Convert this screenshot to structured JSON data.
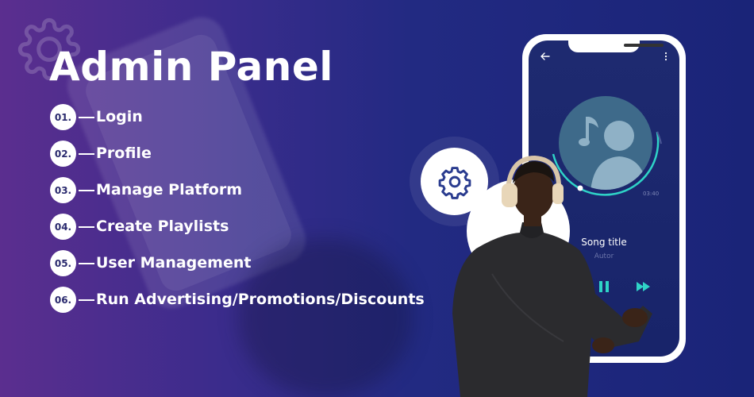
{
  "banner": {
    "title": "Admin Panel",
    "items": [
      {
        "number": "01.",
        "label": "Login"
      },
      {
        "number": "02.",
        "label": "Profile"
      },
      {
        "number": "03.",
        "label": "Manage Platform"
      },
      {
        "number": "04.",
        "label": "Create Playlists"
      },
      {
        "number": "05.",
        "label": "User Management"
      },
      {
        "number": "06.",
        "label": "Run Advertising/Promotions/Discounts"
      }
    ]
  },
  "player": {
    "song_title": "Song title",
    "artist": "Autor",
    "elapsed": "03:40",
    "plus": "+"
  },
  "colors": {
    "accent_teal": "#2fd3c7",
    "background_left": "#5b2e8f",
    "background_right": "#1a2478",
    "screen": "#1e2a70",
    "album": "#3e6a8a"
  },
  "icons": [
    "gear-icon",
    "back-arrow-icon",
    "more-vertical-icon",
    "music-note-icon",
    "user-avatar-icon",
    "rewind-icon",
    "pause-icon",
    "fast-forward-icon"
  ]
}
